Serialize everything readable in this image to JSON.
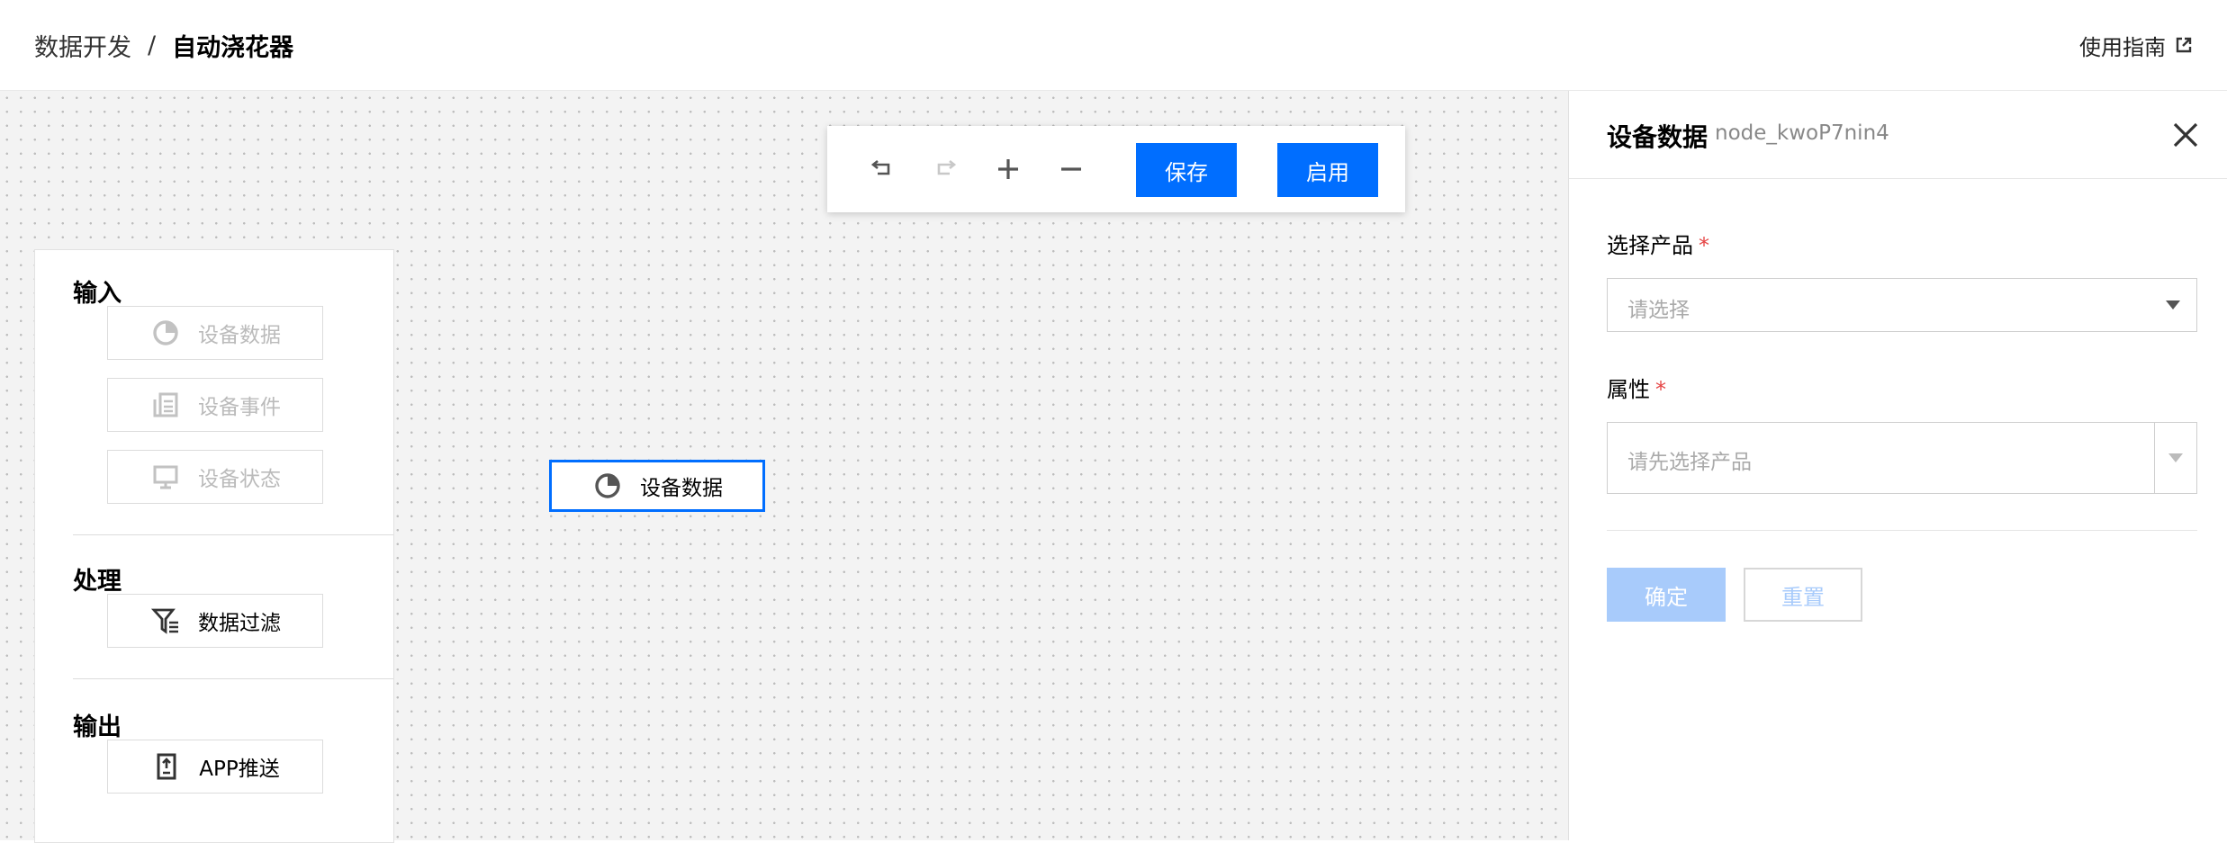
{
  "header": {
    "breadcrumb_parent": "数据开发",
    "breadcrumb_separator": "/",
    "breadcrumb_current": "自动浇花器",
    "guide_link": "使用指南"
  },
  "toolbar": {
    "undo_icon": "undo-icon",
    "redo_icon": "redo-icon",
    "zoom_in_icon": "plus-icon",
    "zoom_out_icon": "minus-icon",
    "save_label": "保存",
    "enable_label": "启用",
    "accent_color": "#006eff"
  },
  "palette": {
    "input_title": "输入",
    "input_items": [
      {
        "label": "设备数据",
        "icon": "pie-chart-icon",
        "state": "disabled"
      },
      {
        "label": "设备事件",
        "icon": "event-icon",
        "state": "disabled"
      },
      {
        "label": "设备状态",
        "icon": "monitor-icon",
        "state": "disabled"
      }
    ],
    "process_title": "处理",
    "process_items": [
      {
        "label": "数据过滤",
        "icon": "filter-icon",
        "state": "enabled"
      }
    ],
    "output_title": "输出",
    "output_items": [
      {
        "label": "APP推送",
        "icon": "app-push-icon",
        "state": "enabled"
      }
    ]
  },
  "canvas_node": {
    "label": "设备数据",
    "icon": "pie-chart-icon",
    "selected": true
  },
  "panel": {
    "title": "设备数据",
    "node_id": "node_kwoP7nin4",
    "product_label": "选择产品",
    "product_placeholder": "请选择",
    "attribute_label": "属性",
    "attribute_placeholder": "请先选择产品",
    "required_mark": "*",
    "confirm_label": "确定",
    "reset_label": "重置"
  }
}
